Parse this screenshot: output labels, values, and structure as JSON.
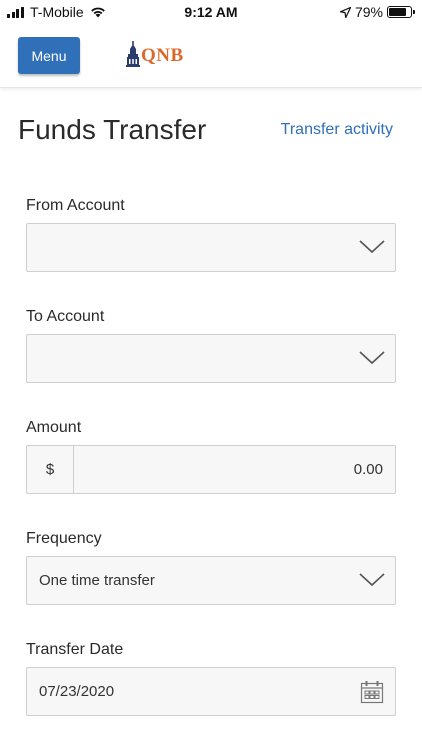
{
  "status_bar": {
    "carrier": "T-Mobile",
    "time": "9:12 AM",
    "battery": "79%",
    "battery_level": 0.79,
    "icons": [
      "signal-icon",
      "wifi-icon",
      "location-arrow-icon",
      "battery-icon"
    ]
  },
  "header": {
    "menu_label": "Menu",
    "logo_text": "QNB",
    "accent_color": "#2f70b8",
    "logo_color": "#d86a2a"
  },
  "page": {
    "title": "Funds Transfer",
    "activity_link": "Transfer activity"
  },
  "form": {
    "from_account": {
      "label": "From Account",
      "value": ""
    },
    "to_account": {
      "label": "To Account",
      "value": ""
    },
    "amount": {
      "label": "Amount",
      "currency": "$",
      "placeholder": "0.00"
    },
    "frequency": {
      "label": "Frequency",
      "value": "One time transfer"
    },
    "transfer_date": {
      "label": "Transfer Date",
      "value": "07/23/2020"
    }
  }
}
